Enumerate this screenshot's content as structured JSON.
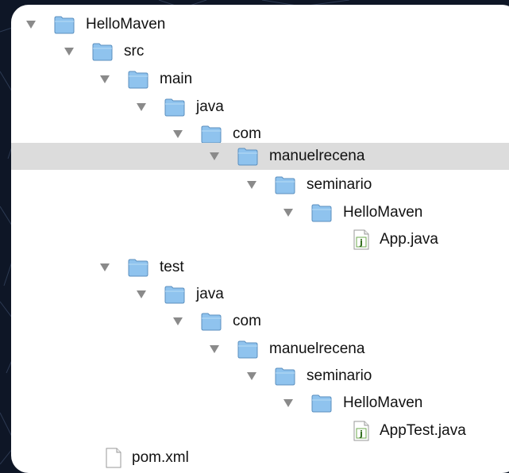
{
  "tree": {
    "items": [
      {
        "label": "HelloMaven",
        "icon": "folder-icon",
        "expanded": true,
        "selected": false
      },
      {
        "label": "src",
        "icon": "folder-icon",
        "expanded": true,
        "selected": false
      },
      {
        "label": "main",
        "icon": "folder-icon",
        "expanded": true,
        "selected": false
      },
      {
        "label": "java",
        "icon": "folder-icon",
        "expanded": true,
        "selected": false
      },
      {
        "label": "com",
        "icon": "folder-icon",
        "expanded": true,
        "selected": false
      },
      {
        "label": "manuelrecena",
        "icon": "folder-icon",
        "expanded": true,
        "selected": true
      },
      {
        "label": "seminario",
        "icon": "folder-icon",
        "expanded": true,
        "selected": false
      },
      {
        "label": "HelloMaven",
        "icon": "folder-icon",
        "expanded": true,
        "selected": false
      },
      {
        "label": "App.java",
        "icon": "java-file-icon",
        "selected": false
      },
      {
        "label": "test",
        "icon": "folder-icon",
        "expanded": true,
        "selected": false
      },
      {
        "label": "java",
        "icon": "folder-icon",
        "expanded": true,
        "selected": false
      },
      {
        "label": "com",
        "icon": "folder-icon",
        "expanded": true,
        "selected": false
      },
      {
        "label": "manuelrecena",
        "icon": "folder-icon",
        "expanded": true,
        "selected": false
      },
      {
        "label": "seminario",
        "icon": "folder-icon",
        "expanded": true,
        "selected": false
      },
      {
        "label": "HelloMaven",
        "icon": "folder-icon",
        "expanded": true,
        "selected": false
      },
      {
        "label": "AppTest.java",
        "icon": "java-file-icon",
        "selected": false
      },
      {
        "label": "pom.xml",
        "icon": "document-icon",
        "selected": false
      }
    ]
  },
  "colors": {
    "background": "#0e1626",
    "panel": "#ffffff",
    "selection": "#dcdcdc",
    "folder": "#8fc3ee",
    "disclosure": "#8a8a8a"
  }
}
